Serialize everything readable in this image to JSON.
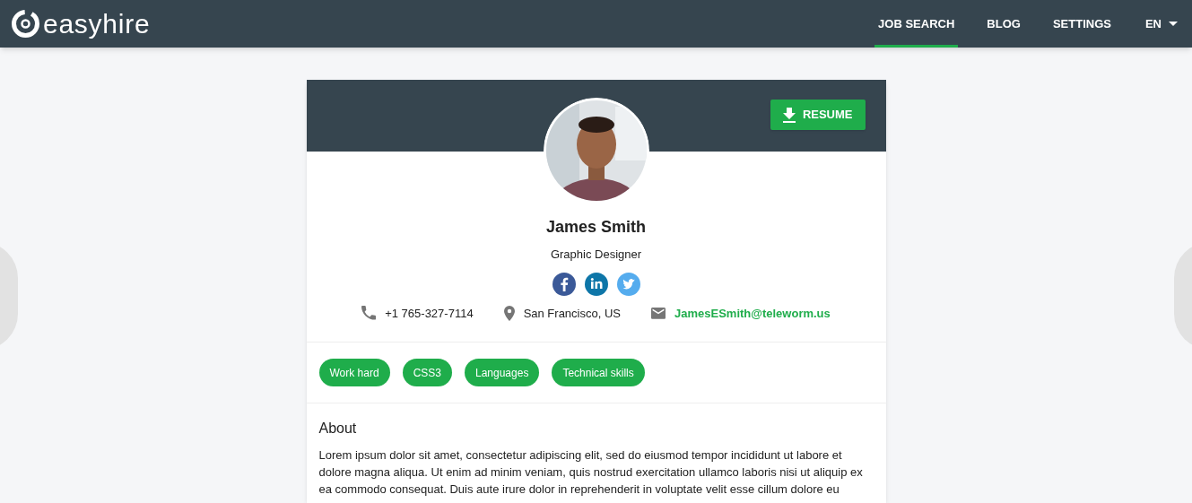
{
  "header": {
    "logo": "easyhire",
    "nav": [
      {
        "label": "JOB SEARCH",
        "selected": true
      },
      {
        "label": "BLOG",
        "selected": false
      },
      {
        "label": "SETTINGS",
        "selected": false
      }
    ],
    "language": "EN"
  },
  "profile": {
    "resume_button": "RESUME",
    "name": "James Smith",
    "title": "Graphic Designer",
    "social": [
      {
        "kind": "facebook",
        "color": "#3b5998"
      },
      {
        "kind": "linkedin",
        "color": "#0e76a8"
      },
      {
        "kind": "twitter",
        "color": "#55acee"
      }
    ],
    "contacts": [
      {
        "kind": "phone",
        "text": "+1 765-327-7114"
      },
      {
        "kind": "location",
        "text": "San Francisco, US"
      },
      {
        "kind": "email",
        "text": "JamesESmith@teleworm.us"
      }
    ],
    "tags": [
      "Work hard",
      "CSS3",
      "Languages",
      "Technical skills"
    ],
    "about": {
      "heading": "About",
      "text": "Lorem ipsum dolor sit amet, consectetur adipiscing elit, sed do eiusmod tempor incididunt ut labore et dolore magna aliqua. Ut enim ad minim veniam, quis nostrud exercitation ullamco laboris nisi ut aliquip ex ea commodo consequat. Duis aute irure dolor in reprehenderit in voluptate velit esse cillum dolore eu"
    }
  }
}
